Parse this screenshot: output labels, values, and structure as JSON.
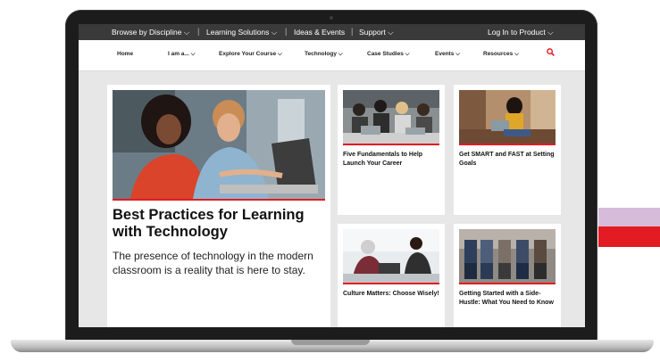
{
  "topbar": {
    "browse": "Browse by Discipline ⌵",
    "learning": "Learning Solutions ⌵",
    "ideas": "Ideas & Events",
    "support": "Support ⌵",
    "login": "Log In to Product ⌵",
    "sep": "|"
  },
  "nav": {
    "home": "Home",
    "iam": "I am a... ⌵",
    "explore": "Explore Your Course ⌵",
    "technology": "Technology ⌵",
    "casestudies": "Case Studies ⌵",
    "events": "Events ⌵",
    "resources": "Resources ⌵"
  },
  "hero": {
    "title": "Best Practices for Learning with Technology",
    "desc": "The presence of technology in the modern classroom is a reality that is here to stay."
  },
  "cards": [
    {
      "title": "Five Fundamentals to Help Launch Your Career"
    },
    {
      "title": "Get SMART and FAST at Setting Goals"
    },
    {
      "title": "Culture Matters: Choose Wisely!"
    },
    {
      "title": "Getting Started with a Side-Hustle: What You Need to Know"
    }
  ],
  "colors": {
    "accent": "#e31b23",
    "topbar": "#3a3a3a",
    "background": "#e7e7e7"
  },
  "icons": {
    "search": "search-icon"
  }
}
